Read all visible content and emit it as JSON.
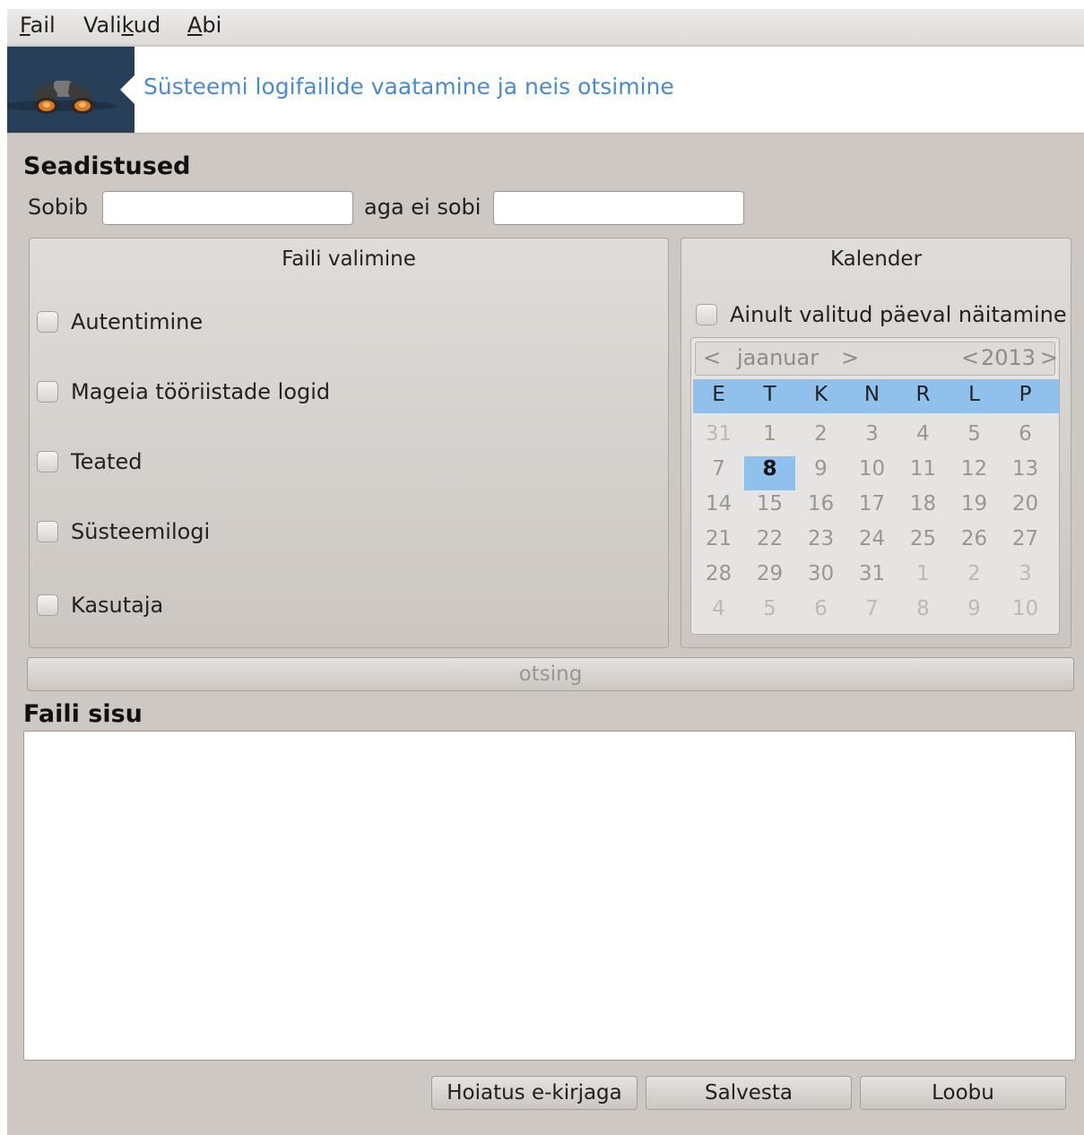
{
  "menubar": {
    "file": {
      "mnemonic": "F",
      "rest": "ail"
    },
    "options": {
      "pre": "Vali",
      "mnemonic": "k",
      "rest": "ud"
    },
    "help": {
      "mnemonic": "A",
      "rest": "bi"
    }
  },
  "banner": {
    "title": "Süsteemi logifailide vaatamine ja neis otsimine",
    "icon": "binoculars-icon"
  },
  "settings": {
    "heading": "Seadistused",
    "match_label": "Sobib",
    "match_value": "",
    "nomatch_label": "aga ei sobi",
    "nomatch_value": ""
  },
  "file_selection": {
    "title": "Faili valimine",
    "items": [
      {
        "label": "Autentimine",
        "checked": false
      },
      {
        "label": "Mageia tööriistade logid",
        "checked": false
      },
      {
        "label": "Teated",
        "checked": false
      },
      {
        "label": "Süsteemilogi",
        "checked": false
      },
      {
        "label": "Kasutaja",
        "checked": false
      }
    ]
  },
  "calendar": {
    "title": "Kalender",
    "only_selected_day_label": "Ainult valitud päeval näitamine",
    "month": "jaanuar",
    "year": "2013",
    "prev": "<",
    "next": ">",
    "day_names": [
      "E",
      "T",
      "K",
      "N",
      "R",
      "L",
      "P"
    ],
    "weeks": [
      [
        "31",
        "1",
        "2",
        "3",
        "4",
        "5",
        "6"
      ],
      [
        "7",
        "8",
        "9",
        "10",
        "11",
        "12",
        "13"
      ],
      [
        "14",
        "15",
        "16",
        "17",
        "18",
        "19",
        "20"
      ],
      [
        "21",
        "22",
        "23",
        "24",
        "25",
        "26",
        "27"
      ],
      [
        "28",
        "29",
        "30",
        "31",
        "1",
        "2",
        "3"
      ],
      [
        "4",
        "5",
        "6",
        "7",
        "8",
        "9",
        "10"
      ]
    ],
    "selected_day": "8"
  },
  "search_button": "otsing",
  "content": {
    "heading": "Faili sisu",
    "text": ""
  },
  "buttons": {
    "mail_alert": "Hoiatus e-kirjaga",
    "save": "Salvesta",
    "cancel": "Loobu"
  }
}
